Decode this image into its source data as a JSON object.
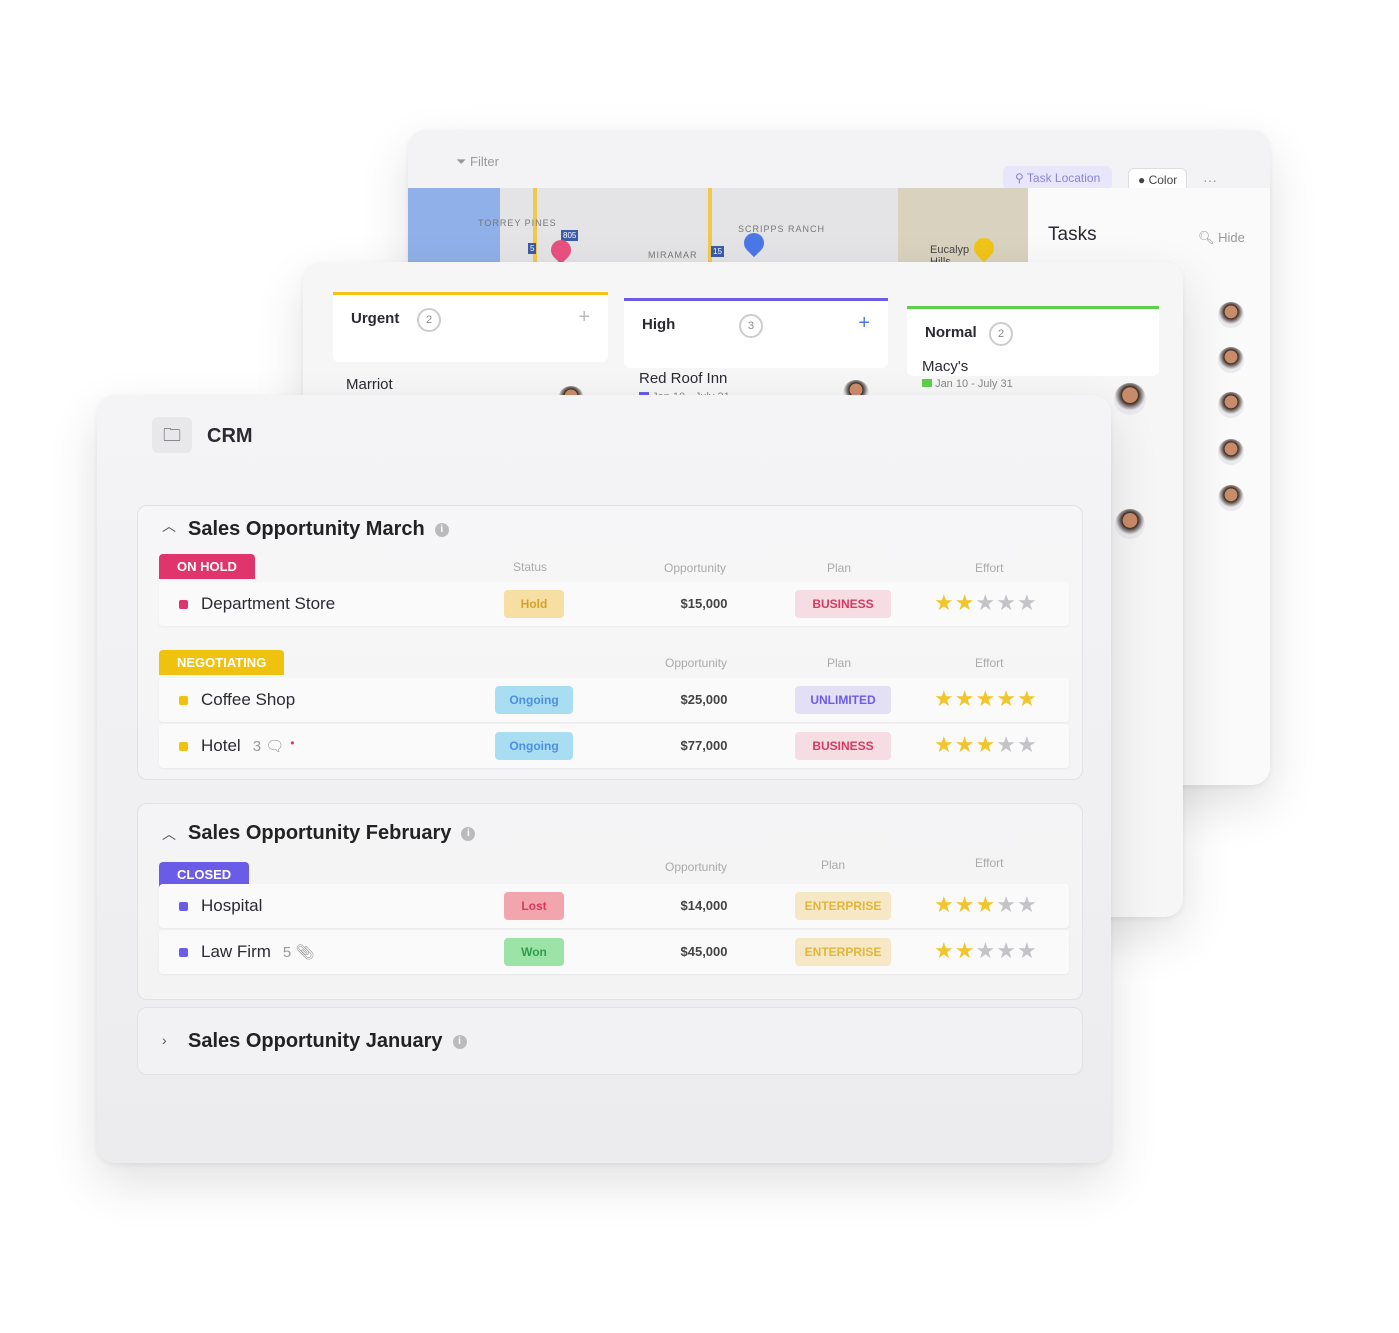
{
  "map_view": {
    "filter_label": "Filter",
    "task_location_label": "Task Location",
    "color_label": "Color",
    "more_label": "···",
    "map_labels": [
      "TORREY PINES",
      "SCRIPPS RANCH",
      "MIRAMAR",
      "Eucalyp Hills"
    ],
    "highway_shields": [
      "805",
      "5",
      "15"
    ],
    "pin_colors": [
      "#e8507f",
      "#4b78e6",
      "#f0c419"
    ],
    "tasks_title": "Tasks",
    "hide_label": "Hide"
  },
  "board": {
    "columns": [
      {
        "name": "Urgent",
        "count": "2",
        "color": "#f2c419",
        "cards": [
          {
            "title": "Marriot"
          }
        ]
      },
      {
        "name": "High",
        "count": "3",
        "color": "#6b5ce7",
        "cards": [
          {
            "title": "Red Roof Inn",
            "dates": "Jan 10 - July 31"
          }
        ]
      },
      {
        "name": "Normal",
        "count": "2",
        "color": "#5fce4c",
        "cards": [
          {
            "title": "Macy's",
            "dates": "Jan 10 - July 31"
          }
        ]
      }
    ]
  },
  "crm": {
    "title": "CRM",
    "headers": {
      "status": "Status",
      "opportunity": "Opportunity",
      "plan": "Plan",
      "effort": "Effort"
    },
    "groups": [
      {
        "title": "Sales Opportunity March",
        "expanded": true,
        "sections": [
          {
            "tag": "ON HOLD",
            "color": "#e0346c",
            "rows": [
              {
                "name": "Department Store",
                "status": "Hold",
                "opportunity": "$15,000",
                "plan": "BUSINESS",
                "effort": 2
              }
            ]
          },
          {
            "tag": "NEGOTIATING",
            "color": "#efc20f",
            "rows": [
              {
                "name": "Coffee Shop",
                "status": "Ongoing",
                "opportunity": "$25,000",
                "plan": "UNLIMITED",
                "effort": 5
              },
              {
                "name": "Hotel",
                "extra": "3",
                "status": "Ongoing",
                "opportunity": "$77,000",
                "plan": "BUSINESS",
                "effort": 3
              }
            ]
          }
        ]
      },
      {
        "title": "Sales Opportunity February",
        "expanded": true,
        "sections": [
          {
            "tag": "CLOSED",
            "color": "#6b5ce7",
            "rows": [
              {
                "name": "Hospital",
                "status": "Lost",
                "opportunity": "$14,000",
                "plan": "ENTERPRISE",
                "effort": 3
              },
              {
                "name": "Law Firm",
                "extra": "5",
                "status": "Won",
                "opportunity": "$45,000",
                "plan": "ENTERPRISE",
                "effort": 2
              }
            ]
          }
        ]
      },
      {
        "title": "Sales Opportunity January",
        "expanded": false
      }
    ]
  }
}
